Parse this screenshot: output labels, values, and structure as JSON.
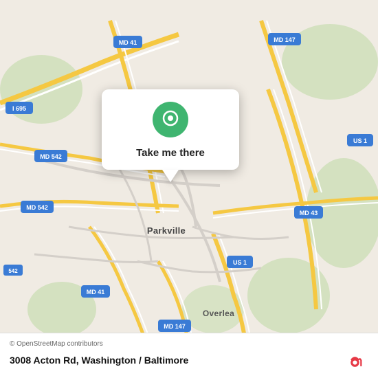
{
  "map": {
    "attribution": "© OpenStreetMap contributors",
    "address": "3008 Acton Rd, Washington / Baltimore",
    "popup": {
      "button_label": "Take me there"
    },
    "labels": {
      "i695": "I 695",
      "md147_top": "MD 147",
      "md41_top": "MD 41",
      "md542_top": "MD 542",
      "md542_mid": "MD 542",
      "us1_top": "US 1",
      "md43": "MD 43",
      "md41_bottom": "MD 41",
      "md147_bottom": "MD 147",
      "us1_bottom": "US 1",
      "parkville": "Parkville",
      "overlea": "Overlea",
      "542": "542"
    },
    "colors": {
      "highway_yellow": "#f5c842",
      "road_white": "#ffffff",
      "road_gray": "#d4cfc9",
      "green_area": "#b8dba8",
      "map_bg": "#f0ebe3",
      "popup_green": "#3fb570"
    }
  }
}
